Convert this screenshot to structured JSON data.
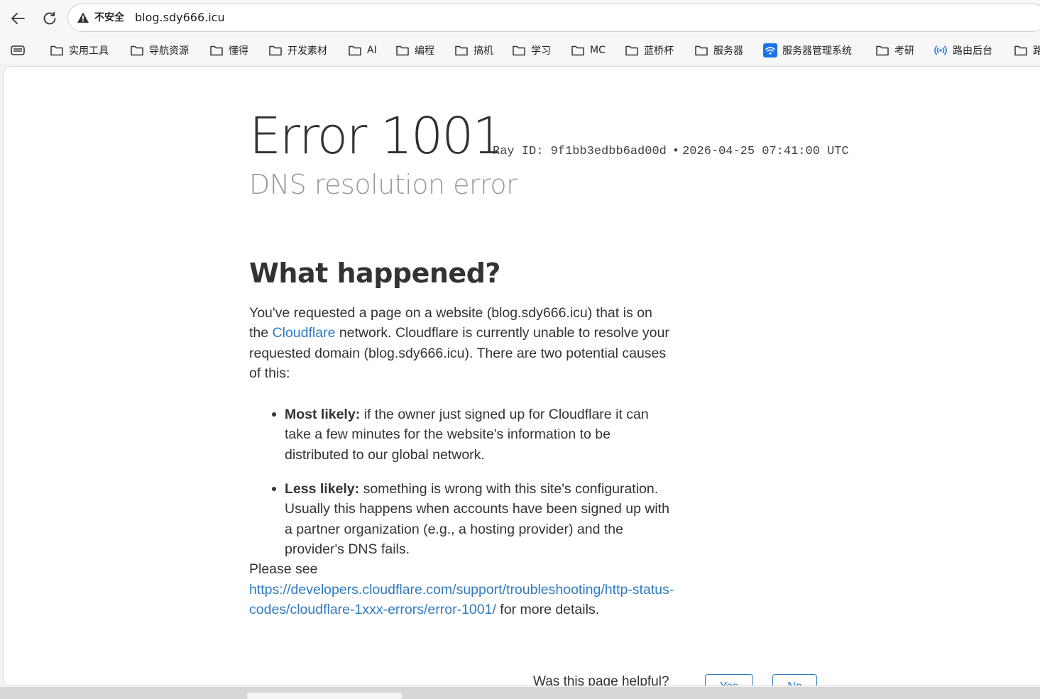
{
  "browser": {
    "not_secure_label": "不安全",
    "url": "blog.sdy666.icu",
    "icons": {
      "back": "arrow-left-icon",
      "reload": "reload-icon",
      "warning": "warning-triangle-icon",
      "folder": "folder-icon",
      "wifi": "wifi-icon",
      "signal": "signal-icon",
      "reading_list": "reading-list-icon"
    }
  },
  "bookmarks": [
    {
      "label": "实用工具",
      "icon": "folder-icon"
    },
    {
      "label": "导航资源",
      "icon": "folder-icon"
    },
    {
      "label": "懂得",
      "icon": "folder-icon"
    },
    {
      "label": "开发素材",
      "icon": "folder-icon"
    },
    {
      "label": "AI",
      "icon": "folder-icon"
    },
    {
      "label": "编程",
      "icon": "folder-icon"
    },
    {
      "label": "搞机",
      "icon": "folder-icon"
    },
    {
      "label": "学习",
      "icon": "folder-icon"
    },
    {
      "label": "MC",
      "icon": "folder-icon"
    },
    {
      "label": "蓝桥杯",
      "icon": "folder-icon"
    },
    {
      "label": "服务器",
      "icon": "folder-icon"
    },
    {
      "label": "服务器管理系统",
      "icon": "wifi-icon"
    },
    {
      "label": "考研",
      "icon": "folder-icon"
    },
    {
      "label": "路由后台",
      "icon": "signal-icon"
    },
    {
      "label": "路",
      "icon": "folder-icon"
    }
  ],
  "page": {
    "error_title": "Error 1001",
    "ray_id_label": "Ray ID:",
    "ray_id": "9f1bb3edbb6ad00d",
    "separator": "•",
    "timestamp": "2026-04-25 07:41:00 UTC",
    "subtitle": "DNS resolution error",
    "section_heading": "What happened?",
    "intro_part1": "You've requested a page on a website (blog.sdy666.icu) that is on the ",
    "cloudflare_link": "Cloudflare",
    "intro_part2": " network. Cloudflare is currently unable to resolve your requested domain (blog.sdy666.icu). There are two potential causes of this:",
    "bullets": [
      {
        "bold": "Most likely:",
        "text": " if the owner just signed up for Cloudflare it can take a few minutes for the website's information to be distributed to our global network."
      },
      {
        "bold": "Less likely:",
        "text": " something is wrong with this site's configuration. Usually this happens when accounts have been signed up with a partner organization (e.g., a hosting provider) and the provider's DNS fails."
      }
    ],
    "see_prefix": "Please see ",
    "docs_link": "https://developers.cloudflare.com/support/troubleshooting/http-status-codes/cloudflare-1xxx-errors/error-1001/",
    "see_suffix": " for more details.",
    "feedback_question": "Was this page helpful?",
    "feedback_yes": "Yes",
    "feedback_no": "No"
  },
  "colors": {
    "link": "#2f7bbf",
    "title": "#313131",
    "subtitle": "#999999",
    "text": "#333333"
  }
}
